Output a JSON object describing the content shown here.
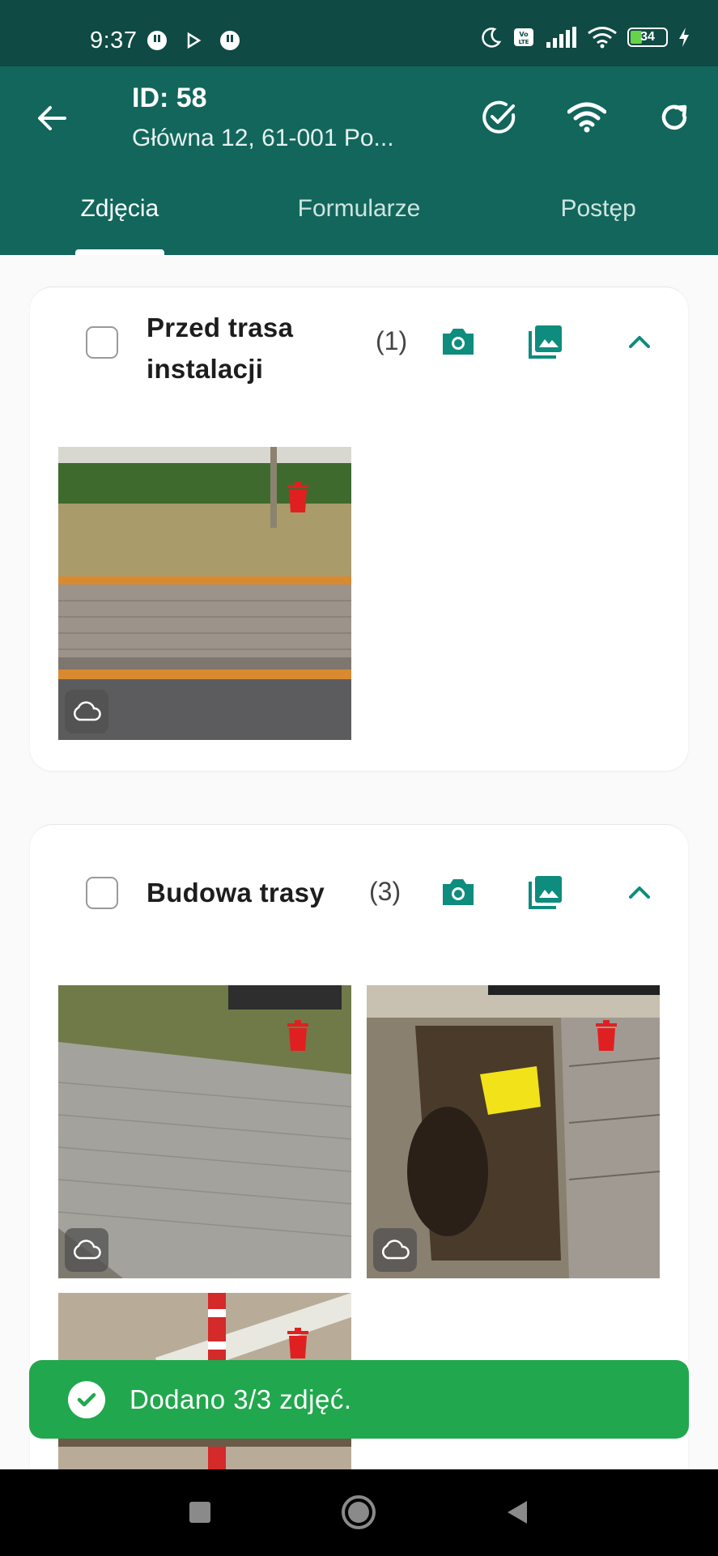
{
  "status_bar": {
    "time": "9:37",
    "battery": "34",
    "icons": [
      "cat-app-icon",
      "play-icon",
      "cat-app-icon",
      "moon-icon",
      "volte-icon",
      "signal-icon",
      "wifi-icon",
      "battery-icon",
      "charging-icon"
    ]
  },
  "header": {
    "title": "ID: 58",
    "subtitle": "Główna 12, 61-001 Po...",
    "actions": [
      "check-circle-icon",
      "wifi-icon",
      "refresh-icon"
    ]
  },
  "tabs": [
    {
      "label": "Zdjęcia",
      "active": true
    },
    {
      "label": "Formularze",
      "active": false
    },
    {
      "label": "Postęp",
      "active": false
    }
  ],
  "sections": [
    {
      "title_line1": "Przed trasa",
      "title_line2": "instalacji",
      "count": "(1)"
    },
    {
      "title_line1": "Budowa trasy",
      "title_line2": "",
      "count": "(3)"
    }
  ],
  "snackbar": {
    "message": "Dodano 3/3 zdjęć."
  },
  "colors": {
    "status_bar": "#0f4a44",
    "app_bar": "#12665c",
    "accent": "#0e8c7e",
    "snackbar": "#21a74d",
    "delete": "#e02020"
  }
}
